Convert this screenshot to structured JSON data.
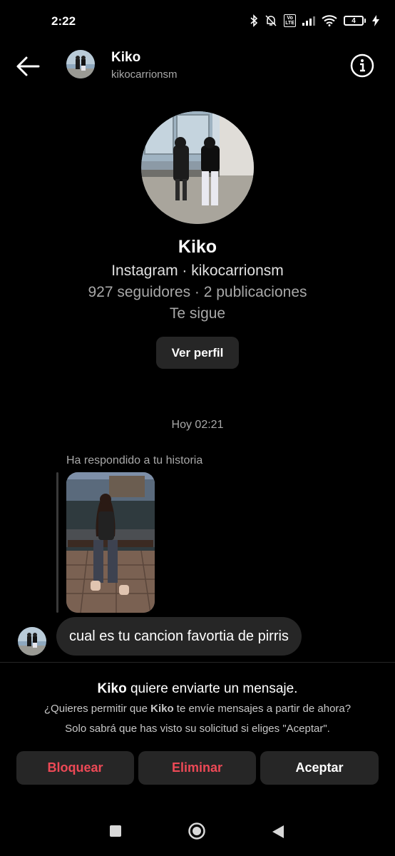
{
  "status_bar": {
    "time": "2:22",
    "lte_label_top": "Vo",
    "lte_label_bottom": "LTE",
    "battery_level": "4",
    "icons": [
      "bluetooth-icon",
      "bell-muted-icon",
      "volte-icon",
      "signal-icon",
      "wifi-icon",
      "battery-icon",
      "charging-icon"
    ]
  },
  "header": {
    "name": "Kiko",
    "username": "kikocarrionsm",
    "back_icon": "arrow-left-icon",
    "info_icon": "info-circle-icon"
  },
  "profile": {
    "name": "Kiko",
    "source": "Instagram · kikocarrionsm",
    "stats": "927 seguidores · 2 publicaciones",
    "follows_you": "Te sigue",
    "view_profile_label": "Ver perfil"
  },
  "chat": {
    "timestamp": "Hoy 02:21",
    "story_reply_label": "Ha respondido a tu historia",
    "message": "cual es tu cancion favortia de pirris"
  },
  "request": {
    "sender": "Kiko",
    "title_rest": " quiere enviarte un mensaje.",
    "line1_before": "¿Quieres permitir que ",
    "line1_name": "Kiko",
    "line1_after": " te envíe mensajes a partir de ahora?",
    "line2": "Solo sabrá que has visto su solicitud si eliges \"Aceptar\".",
    "buttons": {
      "block": "Bloquear",
      "delete": "Eliminar",
      "accept": "Aceptar"
    }
  },
  "colors": {
    "background": "#000000",
    "surface": "#262626",
    "danger": "#ed4956",
    "secondary_text": "#a8a8a8"
  }
}
